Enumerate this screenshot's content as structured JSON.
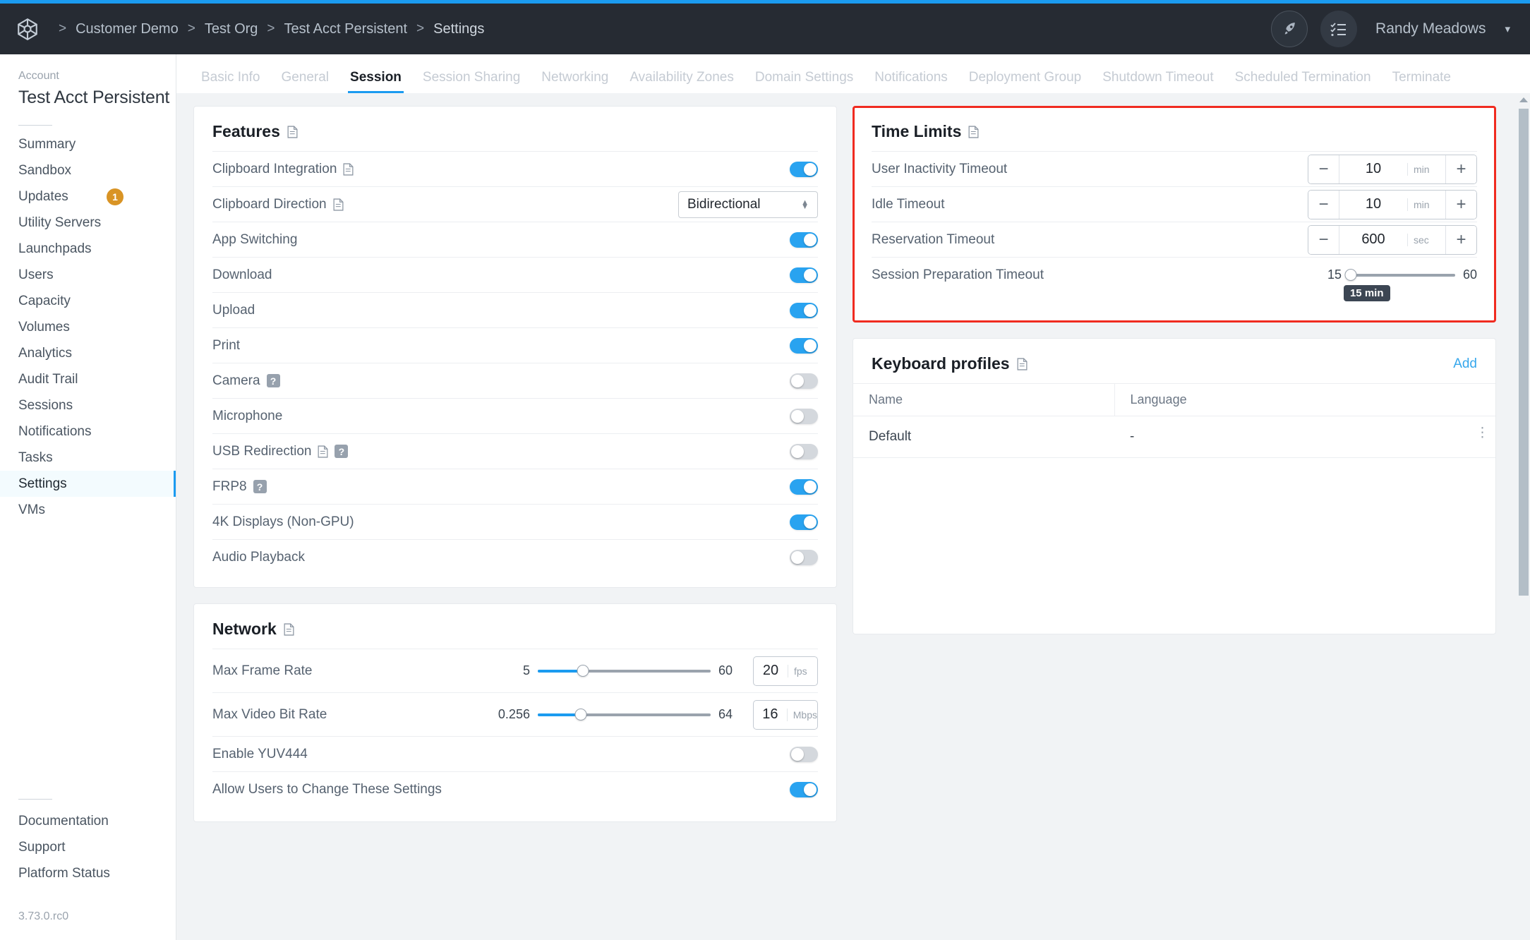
{
  "theme": {
    "accent": "#1b9bf0",
    "header_bg": "#262b33",
    "highlight_border": "#f02b20",
    "badge_color": "#d99425"
  },
  "header": {
    "logo_icon": "cube-hex-logo",
    "breadcrumb": [
      "Customer Demo",
      "Test Org",
      "Test Acct Persistent",
      "Settings"
    ],
    "separator": ">",
    "rocket_icon": "rocket-icon",
    "tasks_icon": "checklist-icon",
    "user_name": "Randy Meadows",
    "caret_icon": "chevron-down-icon"
  },
  "sidebar": {
    "account_label": "Account",
    "account_name": "Test Acct Persistent",
    "items": [
      {
        "label": "Summary",
        "active": false
      },
      {
        "label": "Sandbox",
        "active": false
      },
      {
        "label": "Updates",
        "active": false,
        "badge": "1"
      },
      {
        "label": "Utility Servers",
        "active": false
      },
      {
        "label": "Launchpads",
        "active": false
      },
      {
        "label": "Users",
        "active": false
      },
      {
        "label": "Capacity",
        "active": false
      },
      {
        "label": "Volumes",
        "active": false
      },
      {
        "label": "Analytics",
        "active": false
      },
      {
        "label": "Audit Trail",
        "active": false
      },
      {
        "label": "Sessions",
        "active": false
      },
      {
        "label": "Notifications",
        "active": false
      },
      {
        "label": "Tasks",
        "active": false
      },
      {
        "label": "Settings",
        "active": true
      },
      {
        "label": "VMs",
        "active": false
      }
    ],
    "bottom_items": [
      {
        "label": "Documentation"
      },
      {
        "label": "Support"
      },
      {
        "label": "Platform Status"
      }
    ],
    "version": "3.73.0.rc0"
  },
  "tabs": [
    {
      "label": "Basic Info",
      "active": false
    },
    {
      "label": "General",
      "active": false
    },
    {
      "label": "Session",
      "active": true
    },
    {
      "label": "Session Sharing",
      "active": false
    },
    {
      "label": "Networking",
      "active": false
    },
    {
      "label": "Availability Zones",
      "active": false
    },
    {
      "label": "Domain Settings",
      "active": false
    },
    {
      "label": "Notifications",
      "active": false
    },
    {
      "label": "Deployment Group",
      "active": false
    },
    {
      "label": "Shutdown Timeout",
      "active": false
    },
    {
      "label": "Scheduled Termination",
      "active": false
    },
    {
      "label": "Terminate",
      "active": false
    }
  ],
  "features": {
    "title": "Features",
    "has_doc_icon": true,
    "rows": [
      {
        "label": "Clipboard Integration",
        "doc": true,
        "help": false,
        "control": "toggle",
        "on": true
      },
      {
        "label": "Clipboard Direction",
        "doc": true,
        "help": false,
        "control": "select",
        "value": "Bidirectional"
      },
      {
        "label": "App Switching",
        "doc": false,
        "help": false,
        "control": "toggle",
        "on": true
      },
      {
        "label": "Download",
        "doc": false,
        "help": false,
        "control": "toggle",
        "on": true
      },
      {
        "label": "Upload",
        "doc": false,
        "help": false,
        "control": "toggle",
        "on": true
      },
      {
        "label": "Print",
        "doc": false,
        "help": false,
        "control": "toggle",
        "on": true
      },
      {
        "label": "Camera",
        "doc": false,
        "help": true,
        "control": "toggle",
        "on": false
      },
      {
        "label": "Microphone",
        "doc": false,
        "help": false,
        "control": "toggle",
        "on": false
      },
      {
        "label": "USB Redirection",
        "doc": true,
        "help": true,
        "control": "toggle",
        "on": false
      },
      {
        "label": "FRP8",
        "doc": false,
        "help": true,
        "control": "toggle",
        "on": true
      },
      {
        "label": "4K Displays (Non-GPU)",
        "doc": false,
        "help": false,
        "control": "toggle",
        "on": true
      },
      {
        "label": "Audio Playback",
        "doc": false,
        "help": false,
        "control": "toggle",
        "on": false
      }
    ]
  },
  "time_limits": {
    "title": "Time Limits",
    "highlighted": true,
    "rows": [
      {
        "label": "User Inactivity Timeout",
        "control": "stepper",
        "value": "10",
        "unit": "min",
        "minus": "−",
        "plus": "+"
      },
      {
        "label": "Idle Timeout",
        "control": "stepper",
        "value": "10",
        "unit": "min",
        "minus": "−",
        "plus": "+"
      },
      {
        "label": "Reservation Timeout",
        "control": "stepper",
        "value": "600",
        "unit": "sec",
        "minus": "−",
        "plus": "+"
      },
      {
        "label": "Session Preparation Timeout",
        "control": "slider",
        "min": "15",
        "max": "60",
        "value": 15,
        "tooltip": "15 min",
        "fill_pct": 0
      }
    ]
  },
  "network": {
    "title": "Network",
    "rows": [
      {
        "label": "Max Frame Rate",
        "control": "slider_box",
        "min": "5",
        "max": "60",
        "value": "20",
        "unit": "fps",
        "fill_pct": 26
      },
      {
        "label": "Max Video Bit Rate",
        "control": "slider_box",
        "min": "0.256",
        "max": "64",
        "value": "16",
        "unit": "Mbps",
        "fill_pct": 25
      },
      {
        "label": "Enable YUV444",
        "control": "toggle",
        "on": false
      },
      {
        "label": "Allow Users to Change These Settings",
        "control": "toggle",
        "on": true
      }
    ]
  },
  "keyboard_profiles": {
    "title": "Keyboard profiles",
    "add_label": "Add",
    "columns": [
      "Name",
      "Language"
    ],
    "rows": [
      {
        "name": "Default",
        "language": "-",
        "menu_icon": "kebab-menu-icon"
      }
    ]
  }
}
